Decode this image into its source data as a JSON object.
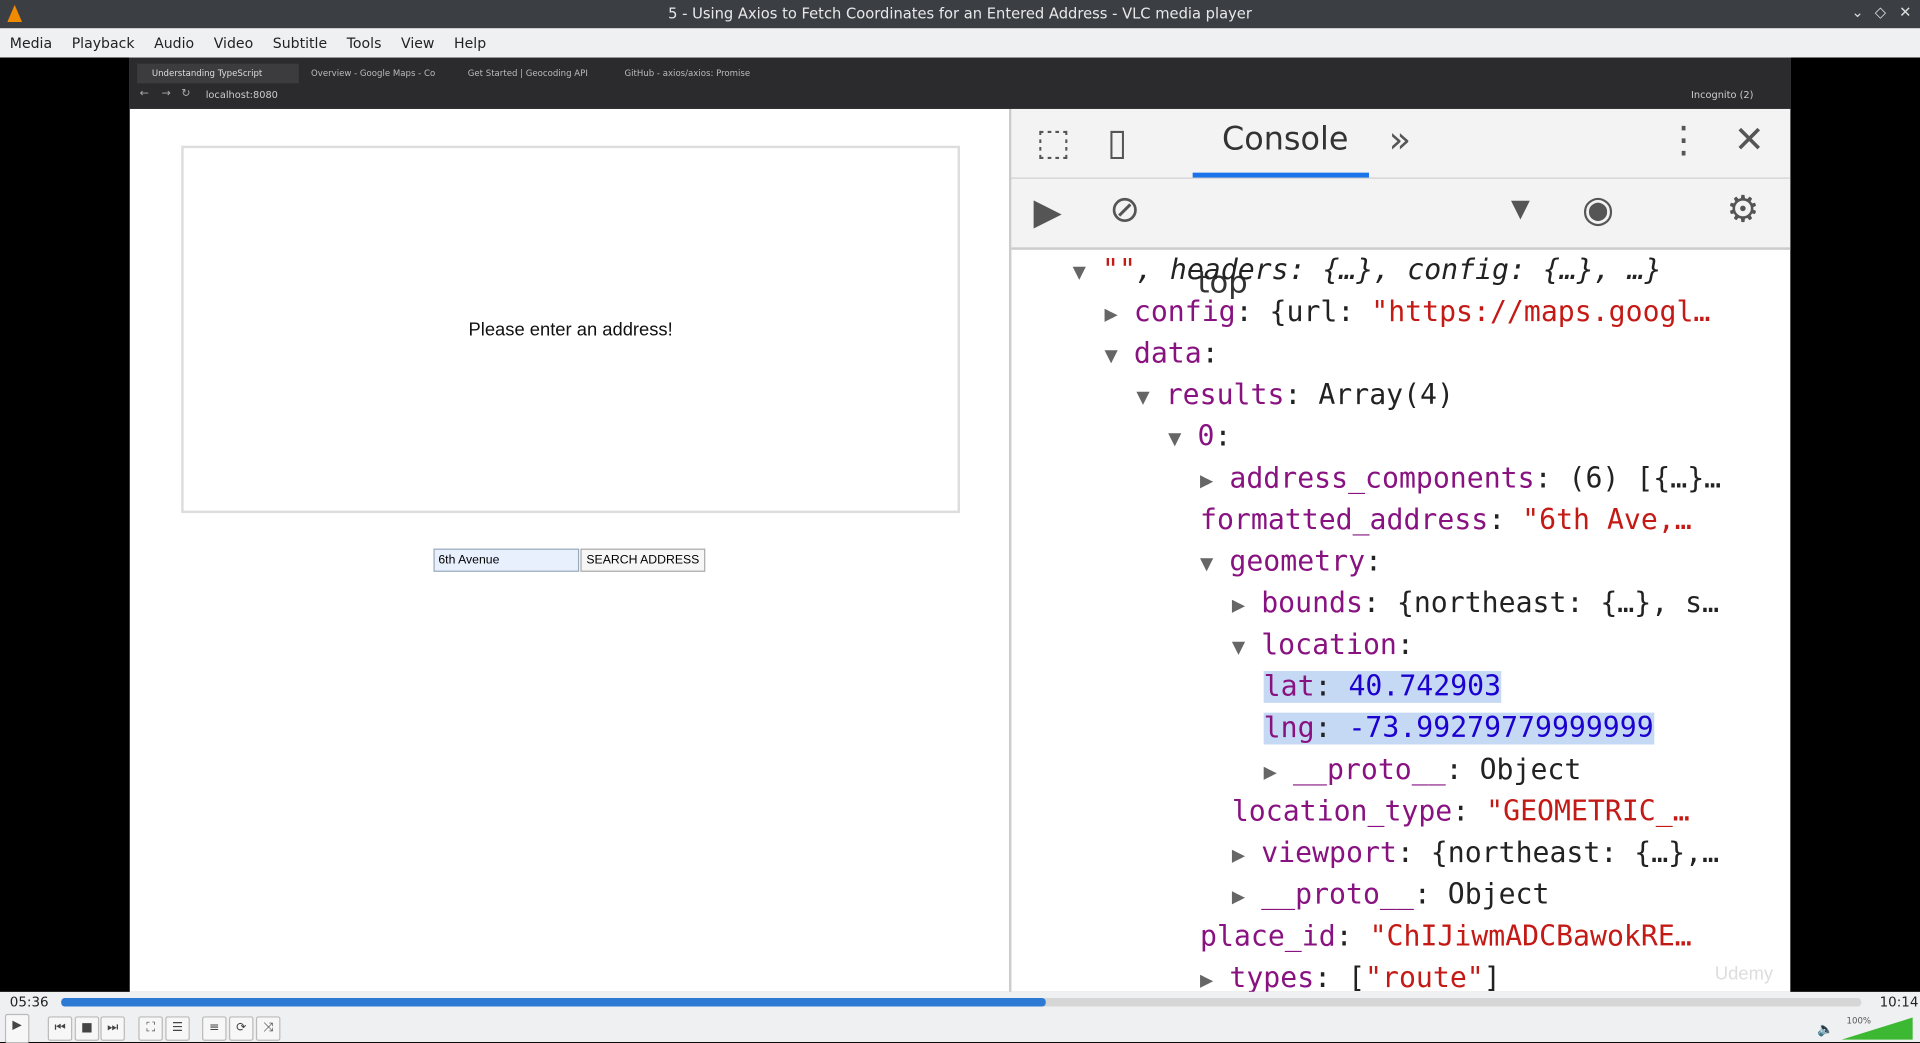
{
  "window": {
    "title": "5 - Using Axios to Fetch Coordinates for an Entered Address - VLC media player",
    "minimize": "⌄",
    "restore": "◇",
    "close": "✕"
  },
  "menu": [
    "Media",
    "Playback",
    "Audio",
    "Video",
    "Subtitle",
    "Tools",
    "View",
    "Help"
  ],
  "browser": {
    "tabs": [
      "Understanding TypeScript",
      "Overview - Google Maps - Co",
      "Get Started | Geocoding API",
      "GitHub - axios/axios: Promise"
    ],
    "address": "localhost:8080",
    "profile": "Incognito (2)"
  },
  "page": {
    "message": "Please enter an address!",
    "input_value": "6th Avenue",
    "search_button": "SEARCH ADDRESS"
  },
  "devtools": {
    "tab": "Console",
    "context": "top",
    "lines": [
      {
        "indent": 0,
        "arrow": "▼",
        "parts": [
          [
            "s",
            "\"\""
          ],
          [
            "i",
            ", headers: {…}, config: {…}, …}"
          ]
        ]
      },
      {
        "indent": 1,
        "arrow": "▶",
        "parts": [
          [
            "k",
            "config"
          ],
          [
            "p",
            ": {url: "
          ],
          [
            "s",
            "\"https://maps.googl…"
          ]
        ]
      },
      {
        "indent": 1,
        "arrow": "▼",
        "parts": [
          [
            "k",
            "data"
          ],
          [
            "p",
            ":"
          ]
        ]
      },
      {
        "indent": 2,
        "arrow": "▼",
        "parts": [
          [
            "k",
            "results"
          ],
          [
            "p",
            ": Array(4)"
          ]
        ]
      },
      {
        "indent": 3,
        "arrow": "▼",
        "parts": [
          [
            "k",
            "0"
          ],
          [
            "p",
            ":"
          ]
        ]
      },
      {
        "indent": 4,
        "arrow": "▶",
        "parts": [
          [
            "k",
            "address_components"
          ],
          [
            "p",
            ": (6) [{…}…"
          ]
        ]
      },
      {
        "indent": 4,
        "arrow": "",
        "parts": [
          [
            "k",
            "formatted_address"
          ],
          [
            "p",
            ": "
          ],
          [
            "s",
            "\"6th Ave,…"
          ]
        ]
      },
      {
        "indent": 4,
        "arrow": "▼",
        "parts": [
          [
            "k",
            "geometry"
          ],
          [
            "p",
            ":"
          ]
        ]
      },
      {
        "indent": 5,
        "arrow": "▶",
        "parts": [
          [
            "k",
            "bounds"
          ],
          [
            "p",
            ": {northeast: {…}, s…"
          ]
        ]
      },
      {
        "indent": 5,
        "arrow": "▼",
        "parts": [
          [
            "k",
            "location"
          ],
          [
            "p",
            ":"
          ]
        ]
      },
      {
        "indent": 6,
        "arrow": "",
        "sel": true,
        "parts": [
          [
            "k",
            "lat"
          ],
          [
            "p",
            ": "
          ],
          [
            "n",
            "40.742903"
          ]
        ]
      },
      {
        "indent": 6,
        "arrow": "",
        "sel": true,
        "parts": [
          [
            "k",
            "lng"
          ],
          [
            "p",
            ": "
          ],
          [
            "n",
            "-73.99279779999999"
          ]
        ]
      },
      {
        "indent": 6,
        "arrow": "▶",
        "parts": [
          [
            "k",
            "__proto__"
          ],
          [
            "p",
            ": Object"
          ]
        ]
      },
      {
        "indent": 5,
        "arrow": "",
        "parts": [
          [
            "k",
            "location_type"
          ],
          [
            "p",
            ": "
          ],
          [
            "s",
            "\"GEOMETRIC_…"
          ]
        ]
      },
      {
        "indent": 5,
        "arrow": "▶",
        "parts": [
          [
            "k",
            "viewport"
          ],
          [
            "p",
            ": {northeast: {…},…"
          ]
        ]
      },
      {
        "indent": 5,
        "arrow": "▶",
        "parts": [
          [
            "k",
            "__proto__"
          ],
          [
            "p",
            ": Object"
          ]
        ]
      },
      {
        "indent": 4,
        "arrow": "",
        "parts": [
          [
            "k",
            "place_id"
          ],
          [
            "p",
            ": "
          ],
          [
            "s",
            "\"ChIJiwmADCBawokRE…"
          ]
        ]
      },
      {
        "indent": 4,
        "arrow": "▶",
        "parts": [
          [
            "k",
            "types"
          ],
          [
            "p",
            ": ["
          ],
          [
            "s",
            "\"route\""
          ],
          [
            "p",
            "]"
          ]
        ]
      }
    ]
  },
  "watermark": "Udemy",
  "player": {
    "elapsed": "05:36",
    "total": "10:14",
    "progress": 0.547,
    "volume": "100%"
  },
  "colors": {
    "key": "#881280",
    "string": "#c41a16",
    "number": "#1c00cf",
    "accent": "#1a73e8",
    "seek": "#2c7ad3"
  }
}
